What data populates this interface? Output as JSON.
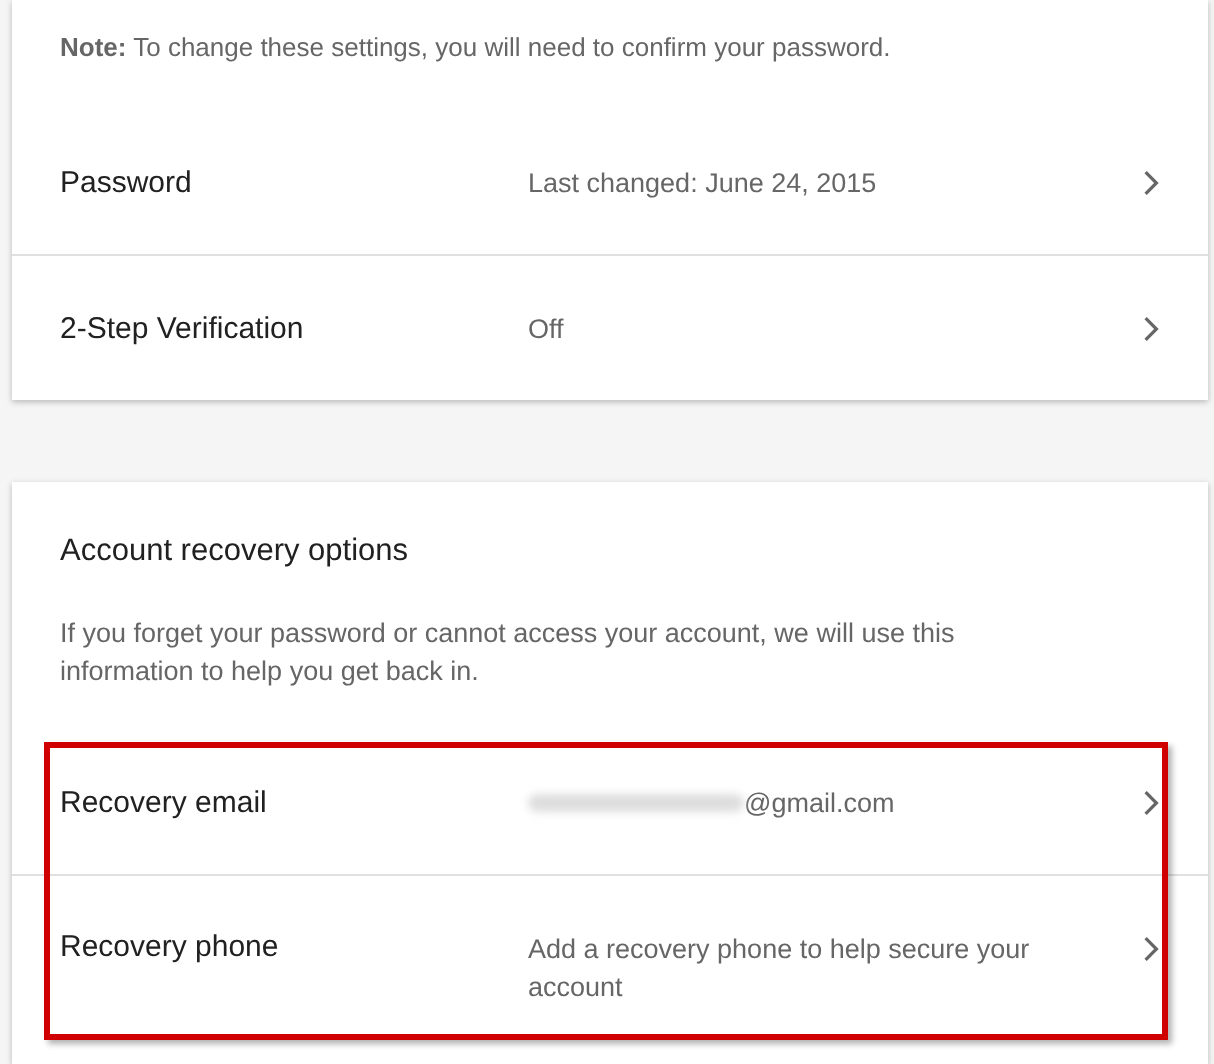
{
  "security_card": {
    "note": "**Note:** To change these settings, you will need to confirm your password.",
    "rows": [
      {
        "label": "Password",
        "value": "Last changed: June 24, 2015"
      },
      {
        "label": "2-Step Verification",
        "value": "Off"
      }
    ]
  },
  "recovery_card": {
    "title": "Account recovery options",
    "description": "If you forget your password or cannot access your account, we will use this information to help you get back in.",
    "highlighted": true,
    "rows": [
      {
        "label": "Recovery email",
        "value": "@gmail.com",
        "redacted_prefix": true
      },
      {
        "label": "Recovery phone",
        "value": "Add a recovery phone to help secure your account",
        "redacted_prefix": false
      }
    ]
  }
}
